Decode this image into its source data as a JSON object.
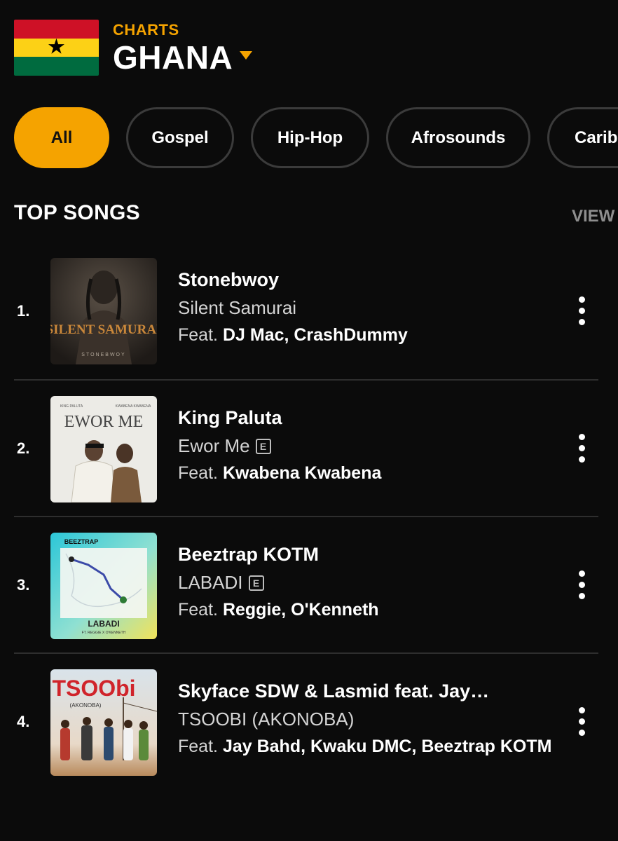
{
  "header": {
    "eyebrow": "CHARTS",
    "country": "GHANA",
    "flag_icon": "ghana-flag",
    "accent_color": "#f5a300"
  },
  "genres": [
    {
      "label": "All",
      "active": true
    },
    {
      "label": "Gospel",
      "active": false
    },
    {
      "label": "Hip-Hop",
      "active": false
    },
    {
      "label": "Afrosounds",
      "active": false
    },
    {
      "label": "Carib",
      "active": false
    }
  ],
  "section": {
    "title": "TOP SONGS",
    "view_all": "VIEW"
  },
  "songs": [
    {
      "rank": "1.",
      "artist": "Stonebwoy",
      "title": "Silent Samurai",
      "explicit": false,
      "feat_label": "Feat.",
      "feat": "DJ Mac, CrashDummy",
      "art_text": "SILENT SAMURAI",
      "art_sub": "STONEBWOY"
    },
    {
      "rank": "2.",
      "artist": "King Paluta",
      "title": "Ewor Me",
      "explicit": true,
      "explicit_label": "E",
      "feat_label": "Feat.",
      "feat": "Kwabena Kwabena",
      "art_text": "EWOR ME",
      "art_sub_left": "KING PALUTA",
      "art_sub_right": "KWABENA KWABENA"
    },
    {
      "rank": "3.",
      "artist": "Beeztrap KOTM",
      "title": "LABADI",
      "explicit": true,
      "explicit_label": "E",
      "feat_label": "Feat.",
      "feat": "Reggie, O'Kenneth",
      "art_text": "LABADI",
      "art_top": "BEEZTRAP",
      "art_sub": "FT. REGGIE X O'KENNETH"
    },
    {
      "rank": "4.",
      "artist": "Skyface SDW & Lasmid feat. Jay…",
      "title": "TSOOBI (AKONOBA)",
      "explicit": false,
      "feat_label": "Feat.",
      "feat": "Jay Bahd, Kwaku DMC, Beeztrap KOTM",
      "art_text": "TSOObi",
      "art_sub": "(AKONOBA)"
    }
  ]
}
